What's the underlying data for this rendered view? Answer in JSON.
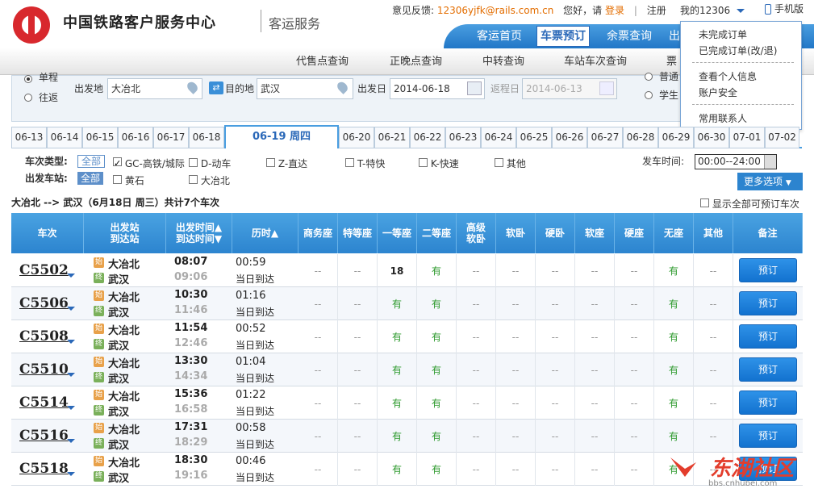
{
  "header": {
    "brand": "中国铁路客户服务中心",
    "brand2": "客运服务",
    "feedback_label": "意见反馈:",
    "feedback_email": "12306yjfk@rails.com.cn",
    "greeting": "您好，请",
    "login": "登录",
    "sep": "|",
    "register": "注册",
    "my12306": "我的12306",
    "mobile": "手机版"
  },
  "nav": {
    "items": [
      "客运首页",
      "车票预订",
      "余票查询",
      "出"
    ],
    "active": "车票预订"
  },
  "subnav": [
    "代售点查询",
    "正晚点查询",
    "中转查询",
    "车站车次查询",
    "票"
  ],
  "dropdown": {
    "items": [
      "未完成订单",
      "已完成订单(改/退)",
      "查看个人信息",
      "账户安全",
      "常用联系人"
    ]
  },
  "form": {
    "oneway": "单程",
    "roundtrip": "往返",
    "from_label": "出发地",
    "from": "大冶北",
    "swap_label": "目的地",
    "to": "武汉",
    "date_label": "出发日",
    "date": "2014-06-18",
    "return_label": "返程日",
    "return_date": "2014-06-13",
    "student": "学生",
    "adult": "普通"
  },
  "dates": [
    "06-13",
    "06-14",
    "06-15",
    "06-16",
    "06-17",
    "06-18",
    "06-19 周四",
    "06-20",
    "06-21",
    "06-22",
    "06-23",
    "06-24",
    "06-25",
    "06-26",
    "06-27",
    "06-28",
    "06-29",
    "06-30",
    "07-01",
    "07-02"
  ],
  "filters": {
    "type_label": "车次类型:",
    "all": "全部",
    "types": [
      "GC-高铁/城际",
      "D-动车",
      "Z-直达",
      "T-特快",
      "K-快速",
      "其他"
    ],
    "station_label": "出发车站:",
    "stations": [
      "黄石",
      "大冶北"
    ],
    "depart_time_label": "发车时间:",
    "depart_time": "00:00--24:00",
    "more": "更多选项"
  },
  "summary": {
    "route": "大冶北 --> 武汉（6月18日 周三）共计7个车次",
    "show_all": "显示全部可预订车次"
  },
  "table": {
    "headers": [
      "车次",
      "出发站\n到达站",
      "出发时间▲\n到达时间▼",
      "历时▲",
      "商务座",
      "特等座",
      "一等座",
      "二等座",
      "高级\n软卧",
      "软卧",
      "硬卧",
      "软座",
      "硬座",
      "无座",
      "其他",
      "备注"
    ],
    "rows": [
      {
        "no": "C5502",
        "from": "大冶北",
        "to": "武汉",
        "dep": "08:07",
        "arr": "09:06",
        "dur": "00:59",
        "arrive": "当日到达",
        "seats": [
          "--",
          "--",
          "18",
          "有",
          "--",
          "--",
          "--",
          "--",
          "--",
          "有",
          "--"
        ]
      },
      {
        "no": "C5506",
        "from": "大冶北",
        "to": "武汉",
        "dep": "10:30",
        "arr": "11:46",
        "dur": "01:16",
        "arrive": "当日到达",
        "seats": [
          "--",
          "--",
          "有",
          "有",
          "--",
          "--",
          "--",
          "--",
          "--",
          "有",
          "--"
        ]
      },
      {
        "no": "C5508",
        "from": "大冶北",
        "to": "武汉",
        "dep": "11:54",
        "arr": "12:46",
        "dur": "00:52",
        "arrive": "当日到达",
        "seats": [
          "--",
          "--",
          "有",
          "有",
          "--",
          "--",
          "--",
          "--",
          "--",
          "有",
          "--"
        ]
      },
      {
        "no": "C5510",
        "from": "大冶北",
        "to": "武汉",
        "dep": "13:30",
        "arr": "14:34",
        "dur": "01:04",
        "arrive": "当日到达",
        "seats": [
          "--",
          "--",
          "有",
          "有",
          "--",
          "--",
          "--",
          "--",
          "--",
          "有",
          "--"
        ]
      },
      {
        "no": "C5514",
        "from": "大冶北",
        "to": "武汉",
        "dep": "15:36",
        "arr": "16:58",
        "dur": "01:22",
        "arrive": "当日到达",
        "seats": [
          "--",
          "--",
          "有",
          "有",
          "--",
          "--",
          "--",
          "--",
          "--",
          "有",
          "--"
        ]
      },
      {
        "no": "C5516",
        "from": "大冶北",
        "to": "武汉",
        "dep": "17:31",
        "arr": "18:29",
        "dur": "00:58",
        "arrive": "当日到达",
        "seats": [
          "--",
          "--",
          "有",
          "有",
          "--",
          "--",
          "--",
          "--",
          "--",
          "有",
          "--"
        ]
      },
      {
        "no": "C5518",
        "from": "大冶北",
        "to": "武汉",
        "dep": "18:30",
        "arr": "19:16",
        "dur": "00:46",
        "arrive": "当日到达",
        "seats": [
          "--",
          "--",
          "有",
          "有",
          "--",
          "--",
          "--",
          "--",
          "--",
          "有",
          "--"
        ]
      }
    ],
    "book": "预订",
    "st_from": "始",
    "st_to": "终"
  },
  "watermark": {
    "text": "东湖社区",
    "url": "bbs.cnhubei.com"
  }
}
